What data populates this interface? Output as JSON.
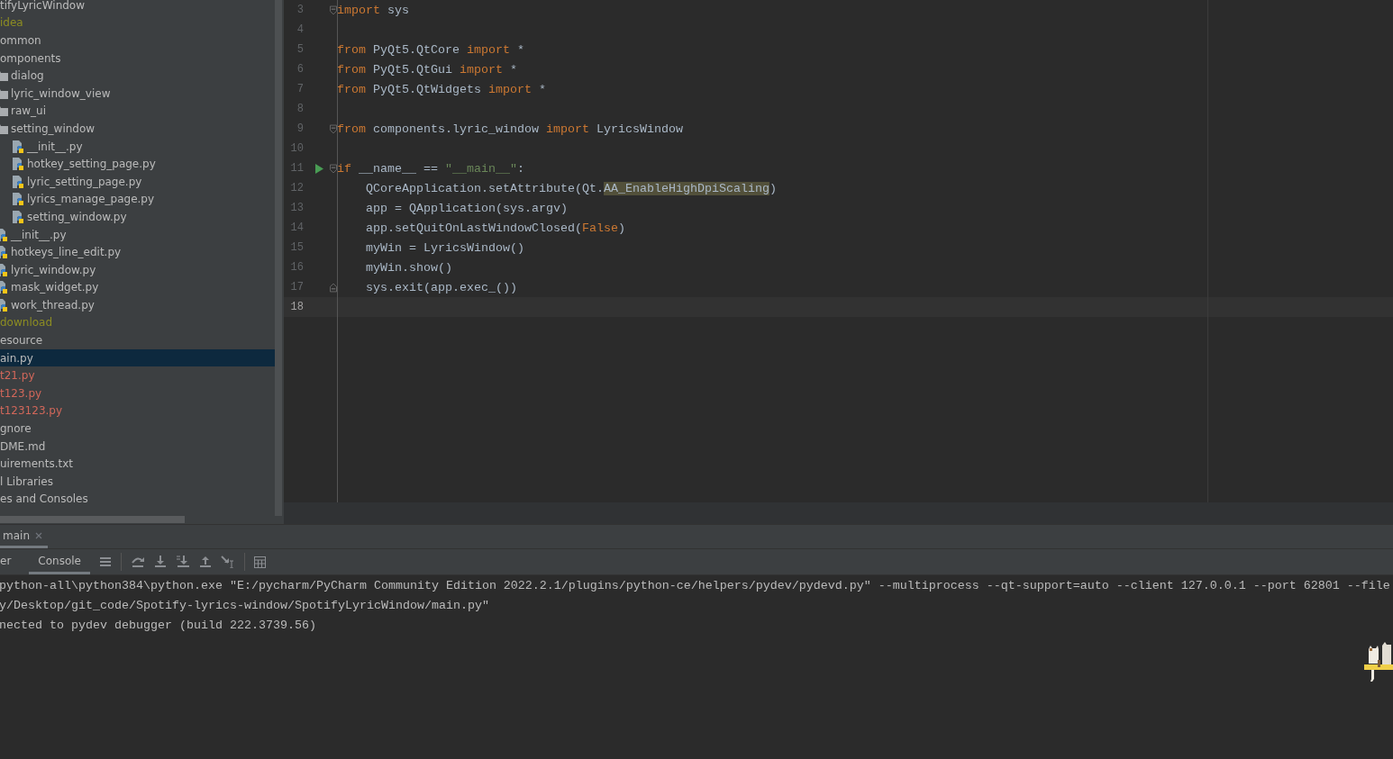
{
  "project_tree": [
    {
      "label": "tifyLyricWindow",
      "color": "#bbbbbb",
      "selected": false
    },
    {
      "label": "idea",
      "color": "#8d8d22",
      "selected": false
    },
    {
      "label": "ommon",
      "color": "#bbbbbb",
      "selected": false
    },
    {
      "label": "omponents",
      "color": "#bbbbbb",
      "selected": false,
      "children": [
        {
          "label": "dialog",
          "kind": "folder",
          "color": "#bbbbbb",
          "selected": false
        },
        {
          "label": "lyric_window_view",
          "kind": "folder",
          "color": "#bbbbbb",
          "selected": false
        },
        {
          "label": "raw_ui",
          "kind": "folder",
          "color": "#bbbbbb",
          "selected": false
        },
        {
          "label": "setting_window",
          "kind": "folder",
          "color": "#bbbbbb",
          "selected": false,
          "children": [
            {
              "label": "__init__.py",
              "kind": "python",
              "color": "#bbbbbb",
              "selected": false
            },
            {
              "label": "hotkey_setting_page.py",
              "kind": "python",
              "color": "#bbbbbb",
              "selected": false
            },
            {
              "label": "lyric_setting_page.py",
              "kind": "python",
              "color": "#bbbbbb",
              "selected": false
            },
            {
              "label": "lyrics_manage_page.py",
              "kind": "python",
              "color": "#bbbbbb",
              "selected": false
            },
            {
              "label": "setting_window.py",
              "kind": "python",
              "color": "#bbbbbb",
              "selected": false
            }
          ]
        },
        {
          "label": "__init__.py",
          "kind": "python",
          "color": "#bbbbbb",
          "selected": false
        },
        {
          "label": "hotkeys_line_edit.py",
          "kind": "python",
          "color": "#bbbbbb",
          "selected": false
        },
        {
          "label": "lyric_window.py",
          "kind": "python",
          "color": "#bbbbbb",
          "selected": false
        },
        {
          "label": "mask_widget.py",
          "kind": "python",
          "color": "#bbbbbb",
          "selected": false
        },
        {
          "label": "work_thread.py",
          "kind": "python",
          "color": "#bbbbbb",
          "selected": false
        }
      ]
    },
    {
      "label": "download",
      "color": "#8d8d22",
      "selected": false
    },
    {
      "label": "esource",
      "color": "#bbbbbb",
      "selected": false
    },
    {
      "label": "ain.py",
      "color": "#bbbbbb",
      "selected": true
    },
    {
      "label": "t21.py",
      "color": "#d1675a",
      "selected": false
    },
    {
      "label": "t123.py",
      "color": "#d1675a",
      "selected": false
    },
    {
      "label": "t123123.py",
      "color": "#d1675a",
      "selected": false
    },
    {
      "label": "gnore",
      "color": "#bbbbbb",
      "selected": false
    },
    {
      "label": "DME.md",
      "color": "#bbbbbb",
      "selected": false
    },
    {
      "label": "uirements.txt",
      "color": "#bbbbbb",
      "selected": false
    },
    {
      "label": "l Libraries",
      "color": "#bbbbbb",
      "selected": false
    },
    {
      "label": "es and Consoles",
      "color": "#bbbbbb",
      "selected": false
    }
  ],
  "editor": {
    "lines": [
      {
        "number": "3",
        "kind": "fold-start",
        "tokens": [
          {
            "kind": "keyword",
            "text": "import"
          },
          {
            "kind": "plain",
            "text": " sys"
          }
        ]
      },
      {
        "number": "4",
        "kind": "plain"
      },
      {
        "number": "5",
        "kind": "plain",
        "tokens": [
          {
            "kind": "keyword",
            "text": "from"
          },
          {
            "kind": "plain",
            "text": " PyQt5.QtCore "
          },
          {
            "kind": "keyword",
            "text": "import"
          },
          {
            "kind": "plain",
            "text": " *"
          }
        ]
      },
      {
        "number": "6",
        "kind": "plain",
        "tokens": [
          {
            "kind": "keyword",
            "text": "from"
          },
          {
            "kind": "plain",
            "text": " PyQt5.QtGui "
          },
          {
            "kind": "keyword",
            "text": "import"
          },
          {
            "kind": "plain",
            "text": " *"
          }
        ]
      },
      {
        "number": "7",
        "kind": "plain",
        "tokens": [
          {
            "kind": "keyword",
            "text": "from"
          },
          {
            "kind": "plain",
            "text": " PyQt5.QtWidgets "
          },
          {
            "kind": "keyword",
            "text": "import"
          },
          {
            "kind": "plain",
            "text": " *"
          }
        ]
      },
      {
        "number": "8",
        "kind": "plain"
      },
      {
        "number": "9",
        "kind": "fold-start",
        "tokens": [
          {
            "kind": "keyword",
            "text": "from"
          },
          {
            "kind": "plain",
            "text": " components.lyric_window "
          },
          {
            "kind": "keyword",
            "text": "import"
          },
          {
            "kind": "plain",
            "text": " LyricsWindow"
          }
        ]
      },
      {
        "number": "10",
        "kind": "plain"
      },
      {
        "number": "11",
        "kind": "fold-start",
        "run": true,
        "tokens": [
          {
            "kind": "keyword",
            "text": "if"
          },
          {
            "kind": "plain",
            "text": " __name__ == "
          },
          {
            "kind": "string",
            "text": "\"__main__\""
          },
          {
            "kind": "plain",
            "text": ":"
          }
        ]
      },
      {
        "number": "12",
        "kind": "plain",
        "tokens": [
          {
            "kind": "plain",
            "text": "    QCoreApplication.setAttribute(Qt."
          },
          {
            "kind": "highlight",
            "text": "AA_EnableHighDpiScaling"
          },
          {
            "kind": "plain",
            "text": ")"
          }
        ]
      },
      {
        "number": "13",
        "kind": "plain",
        "tokens": [
          {
            "kind": "plain",
            "text": "    app = QApplication(sys.argv)"
          }
        ]
      },
      {
        "number": "14",
        "kind": "plain",
        "tokens": [
          {
            "kind": "plain",
            "text": "    app.setQuitOnLastWindowClosed("
          },
          {
            "kind": "keyword",
            "text": "False"
          },
          {
            "kind": "plain",
            "text": ")"
          }
        ]
      },
      {
        "number": "15",
        "kind": "plain",
        "tokens": [
          {
            "kind": "plain",
            "text": "    myWin = LyricsWindow()"
          }
        ]
      },
      {
        "number": "16",
        "kind": "plain",
        "tokens": [
          {
            "kind": "plain",
            "text": "    myWin.show()"
          }
        ]
      },
      {
        "number": "17",
        "kind": "fold-end",
        "tokens": [
          {
            "kind": "plain",
            "text": "    sys.exit(app.exec_())"
          }
        ]
      },
      {
        "number": "18",
        "kind": "plain",
        "current": true
      }
    ]
  },
  "debug_tabs": [
    {
      "label": "main",
      "selected": true
    }
  ],
  "debug_subtabs": [
    {
      "label": "er",
      "selected": false
    },
    {
      "label": "Console",
      "selected": true
    }
  ],
  "console_lines": [
    "python-all\\python384\\python.exe \"E:/pycharm/PyCharm Community Edition 2022.2.1/plugins/python-ce/helpers/pydev/pydevd.py\" --multiprocess --qt-support=auto --client 127.0.0.1 --port 62801 --file",
    "y/Desktop/git_code/Spotify-lyrics-window/SpotifyLyricWindow/main.py\"",
    "nected to pydev debugger (build 222.3739.56)"
  ]
}
